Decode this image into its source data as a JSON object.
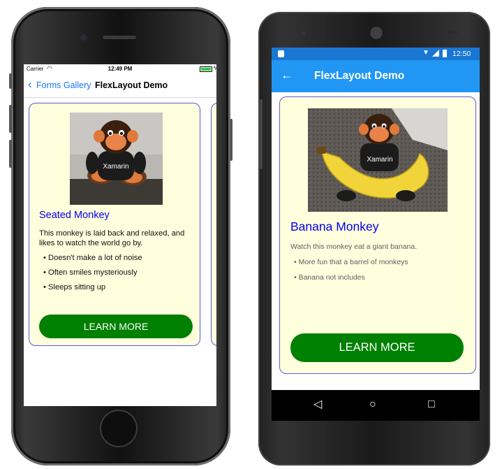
{
  "colors": {
    "ios_accent": "#1877f2",
    "android_status_bar": "#1976d2",
    "android_toolbar": "#2196f3",
    "card_background": "#fffedd",
    "card_border": "#5b5bd6",
    "title_text": "#0000ee",
    "button_background": "#008000"
  },
  "ios": {
    "status": {
      "carrier": "Carrier",
      "time": "12:49 PM"
    },
    "nav": {
      "back_label": "Forms Gallery",
      "title": "FlexLayout Demo"
    },
    "card": {
      "title": "Seated Monkey",
      "description": "This monkey is laid back and relaxed, and likes to watch the world go by.",
      "bullets": [
        "Doesn't make a lot of noise",
        "Often smiles mysteriously",
        "Sleeps sitting up"
      ],
      "button_label": "LEARN MORE",
      "image": "seated-monkey-plush-photo"
    }
  },
  "android": {
    "status": {
      "time": "12:50"
    },
    "toolbar": {
      "title": "FlexLayout Demo",
      "back_icon": "arrow-left-icon"
    },
    "card": {
      "title": "Banana Monkey",
      "description": "Watch this monkey eat a giant banana.",
      "bullets": [
        "More fun that a barrel of monkeys",
        "Banana not includes"
      ],
      "button_label": "LEARN MORE",
      "image": "banana-monkey-plush-photo"
    },
    "navbar": {
      "back_icon": "triangle-back-icon",
      "home_icon": "circle-home-icon",
      "recents_icon": "square-recents-icon"
    }
  }
}
